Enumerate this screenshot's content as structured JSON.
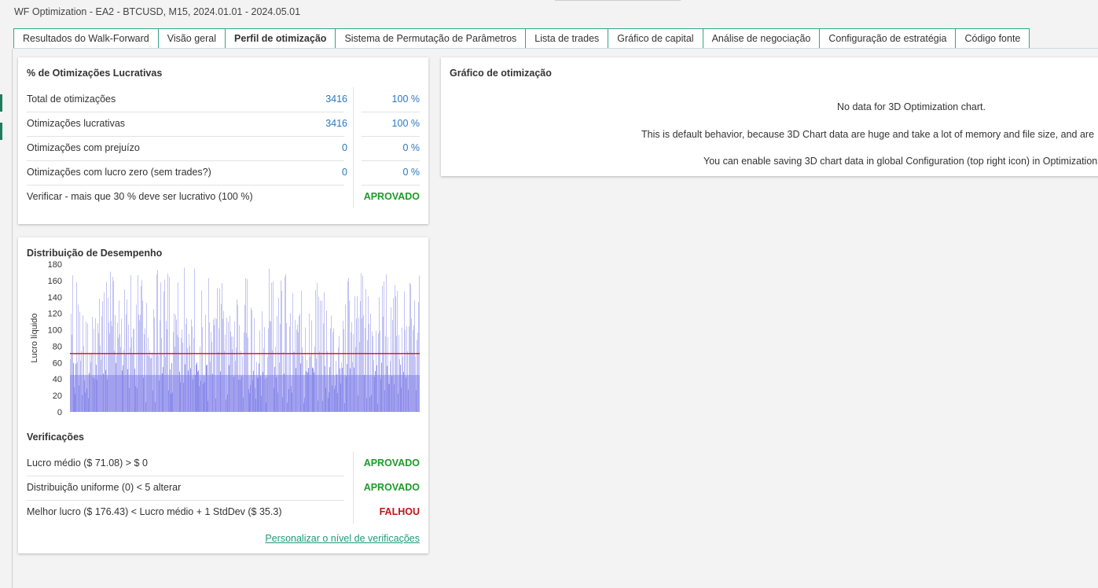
{
  "window": {
    "title": "WF Optimization - EA2 - BTCUSD, M15, 2024.01.01 - 2024.05.01"
  },
  "tabs": [
    {
      "label": "Resultados do Walk-Forward",
      "active": false
    },
    {
      "label": "Visão geral",
      "active": false
    },
    {
      "label": "Perfil de otimização",
      "active": true
    },
    {
      "label": "Sistema de Permutação de Parâmetros",
      "active": false
    },
    {
      "label": "Lista de trades",
      "active": false
    },
    {
      "label": "Gráfico de capital",
      "active": false
    },
    {
      "label": "Análise de negociação",
      "active": false
    },
    {
      "label": "Configuração de estratégia",
      "active": false
    },
    {
      "label": "Código fonte",
      "active": false
    }
  ],
  "profitable": {
    "title": "% de Otimizações Lucrativas",
    "rows": [
      {
        "label": "Total de otimizações",
        "count": "3416",
        "pct": "100 %"
      },
      {
        "label": "Otimizações lucrativas",
        "count": "3416",
        "pct": "100 %"
      },
      {
        "label": "Otimizações com prejuízo",
        "count": "0",
        "pct": "0 %"
      },
      {
        "label": "Otimizações com lucro zero (sem trades?)",
        "count": "0",
        "pct": "0 %"
      }
    ],
    "check": {
      "label": "Verificar - mais que 30 % deve ser lucrativo (100 %)",
      "result": "APROVADO"
    }
  },
  "distribution": {
    "title": "Distribuição de Desempenho",
    "checks_title": "Verificações",
    "checks": [
      {
        "label": "Lucro médio ($ 71.08) > $ 0",
        "result": "APROVADO",
        "status": "pass"
      },
      {
        "label": "Distribuição uniforme (0) < 5 alterar",
        "result": "APROVADO",
        "status": "pass"
      },
      {
        "label": "Melhor lucro ($ 176.43) < Lucro médio + 1 StdDev ($ 35.3)",
        "result": "FALHOU",
        "status": "fail"
      }
    ],
    "customize_link": "Personalizar o nível de verificações"
  },
  "chart_data": {
    "type": "bar",
    "ylabel": "Lucro líquido",
    "ylim": [
      0,
      180
    ],
    "yticks": [
      "0",
      "20",
      "40",
      "60",
      "80",
      "100",
      "120",
      "140",
      "160",
      "180"
    ],
    "n_bars": 3416,
    "value_range": [
      0,
      176.43
    ],
    "mean_line": 71.08,
    "colors": {
      "bar_light": "#b9b9f2",
      "bar_dark": "#8484ea",
      "mean": "#e02020"
    }
  },
  "optimization_chart": {
    "title": "Gráfico de otimização",
    "lines": [
      "No data for 3D Optimization chart.",
      "This is default behavior, because 3D Chart data are huge and take a lot of memory and file size, and are",
      "You can enable saving 3D chart data in global Configuration (top right icon) in Optimization"
    ]
  }
}
